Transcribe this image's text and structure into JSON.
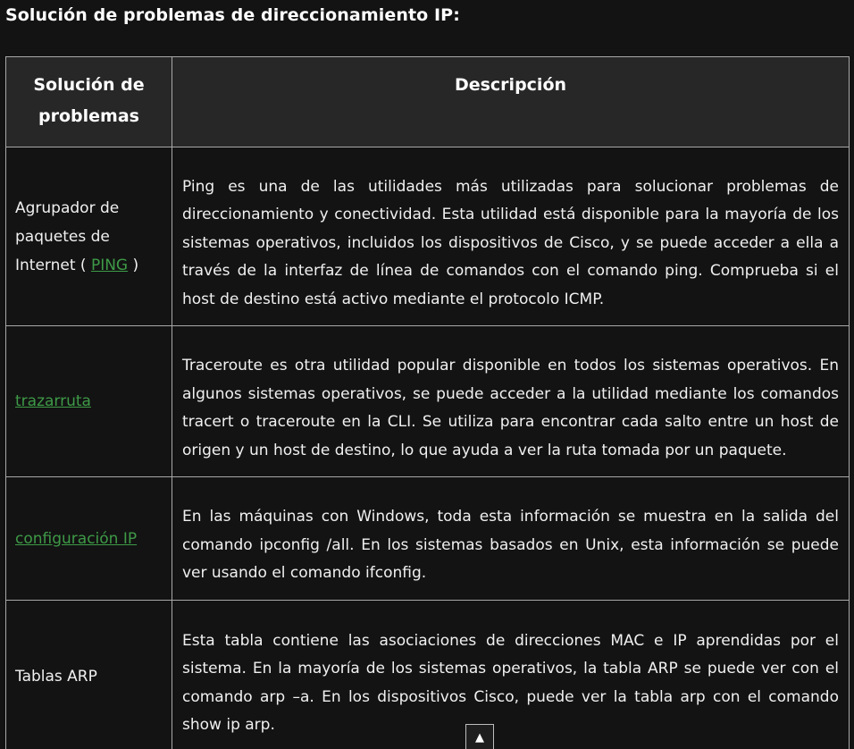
{
  "heading": "Solución de problemas de direccionamiento IP:",
  "table": {
    "headers": {
      "col1": "Solución de problemas",
      "col2": "Descripción"
    },
    "rows": [
      {
        "name_prefix": "Agrupador de paquetes de Internet ( ",
        "name_link": "PING",
        "name_suffix": " )",
        "description": "Ping es una de las utilidades más utilizadas para solucionar problemas de direccionamiento y conectividad. Esta utilidad está disponible para la mayoría de los sistemas operativos, incluidos los dispositivos de Cisco, y se puede acceder a ella a través de la interfaz de línea de comandos con el comando ping. Comprueba si el host de destino está activo mediante el protocolo ICMP."
      },
      {
        "name_link": "trazarruta",
        "description": "Traceroute es otra utilidad popular disponible en todos los sistemas operativos. En algunos sistemas operativos, se puede acceder a la utilidad mediante los comandos tracert o traceroute en la CLI. Se utiliza para encontrar cada salto entre un host de origen y un host de destino, lo que ayuda a ver la ruta tomada por un paquete."
      },
      {
        "name_link": "configuración IP",
        "description": "En las máquinas con Windows, toda esta información se muestra en la salida del comando ipconfig /all. En los sistemas basados en Unix, esta información se puede ver usando el comando ifconfig."
      },
      {
        "name_text": "Tablas ARP",
        "description": "Esta tabla contiene las asociaciones de direcciones MAC e IP aprendidas por el sistema. En la mayoría de los sistemas operativos, la tabla ARP se puede ver con el comando arp –a. En los dispositivos Cisco, puede ver la tabla arp con el comando show ip arp."
      }
    ]
  },
  "scroll_top_glyph": "▲",
  "colors": {
    "background": "#131313",
    "header_bg": "#272727",
    "border": "#a8a8a8",
    "link": "#3e9a47"
  }
}
